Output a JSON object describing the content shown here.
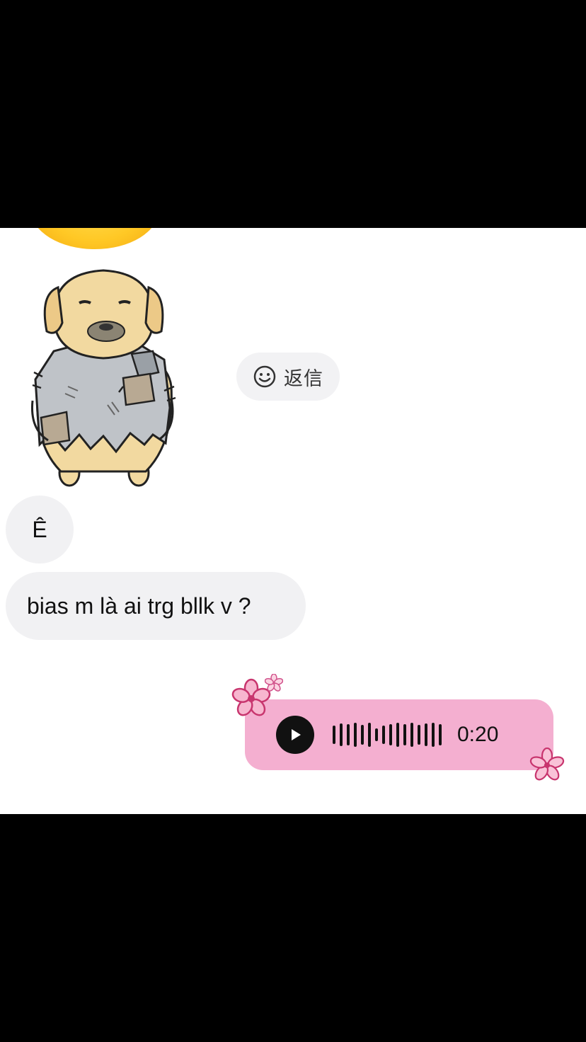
{
  "reply_button": {
    "label": "返信",
    "icon": "smile-icon"
  },
  "messages": [
    {
      "text": "Ê"
    },
    {
      "text": "bias m là ai trg bllk v ?"
    }
  ],
  "voice_message": {
    "duration": "0:20",
    "icon": "play-icon",
    "color": "#f4afd0"
  },
  "sticker": {
    "description_icon": "ragged-dog-sticker"
  },
  "colors": {
    "incoming_bubble": "#f1f1f3",
    "outgoing_voice": "#f4afd0",
    "flower": "#e0457f"
  }
}
